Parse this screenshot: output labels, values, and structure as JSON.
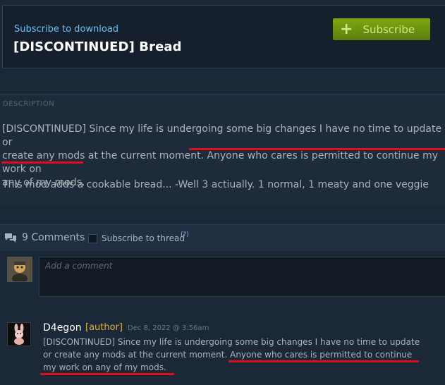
{
  "item": {
    "subscribe_to_download": "Subscribe to download",
    "title": "[DISCONTINUED] Bread",
    "subscribe_button": "Subscribe",
    "colors": {
      "accent_blue": "#67c1f5",
      "subscribe_green": "#7fa80f",
      "author_gold": "#e1b12c",
      "highlight_red": "#e00d1f"
    }
  },
  "description": {
    "label": "DESCRIPTION",
    "line1": "[DISCONTINUED] Since my life is undergoing some big changes I have no time to update or",
    "line2": "create any mods at the current moment. Anyone who cares is permitted to continue my work on",
    "line3": "any of my mods.",
    "line4": "This mod adds a cookable bread... -Well 3 actiually. 1 normal, 1 meaty and one veggie"
  },
  "comments": {
    "icon": "chat-bubbles-icon",
    "count_label": "9 Comments",
    "subscribe_thread": "Subscribe to thread",
    "help": "(?)",
    "add_comment_placeholder": "Add a comment",
    "items": [
      {
        "author": "D4egon",
        "author_tag": "[author]",
        "date": "Dec 8, 2022 @ 3:56am",
        "line1": "[DISCONTINUED] Since my life is undergoing some big changes I have no time to update",
        "line2": "or create any mods at the current moment. Anyone who cares is permitted to continue",
        "line3": "my work on any of my mods."
      }
    ]
  }
}
